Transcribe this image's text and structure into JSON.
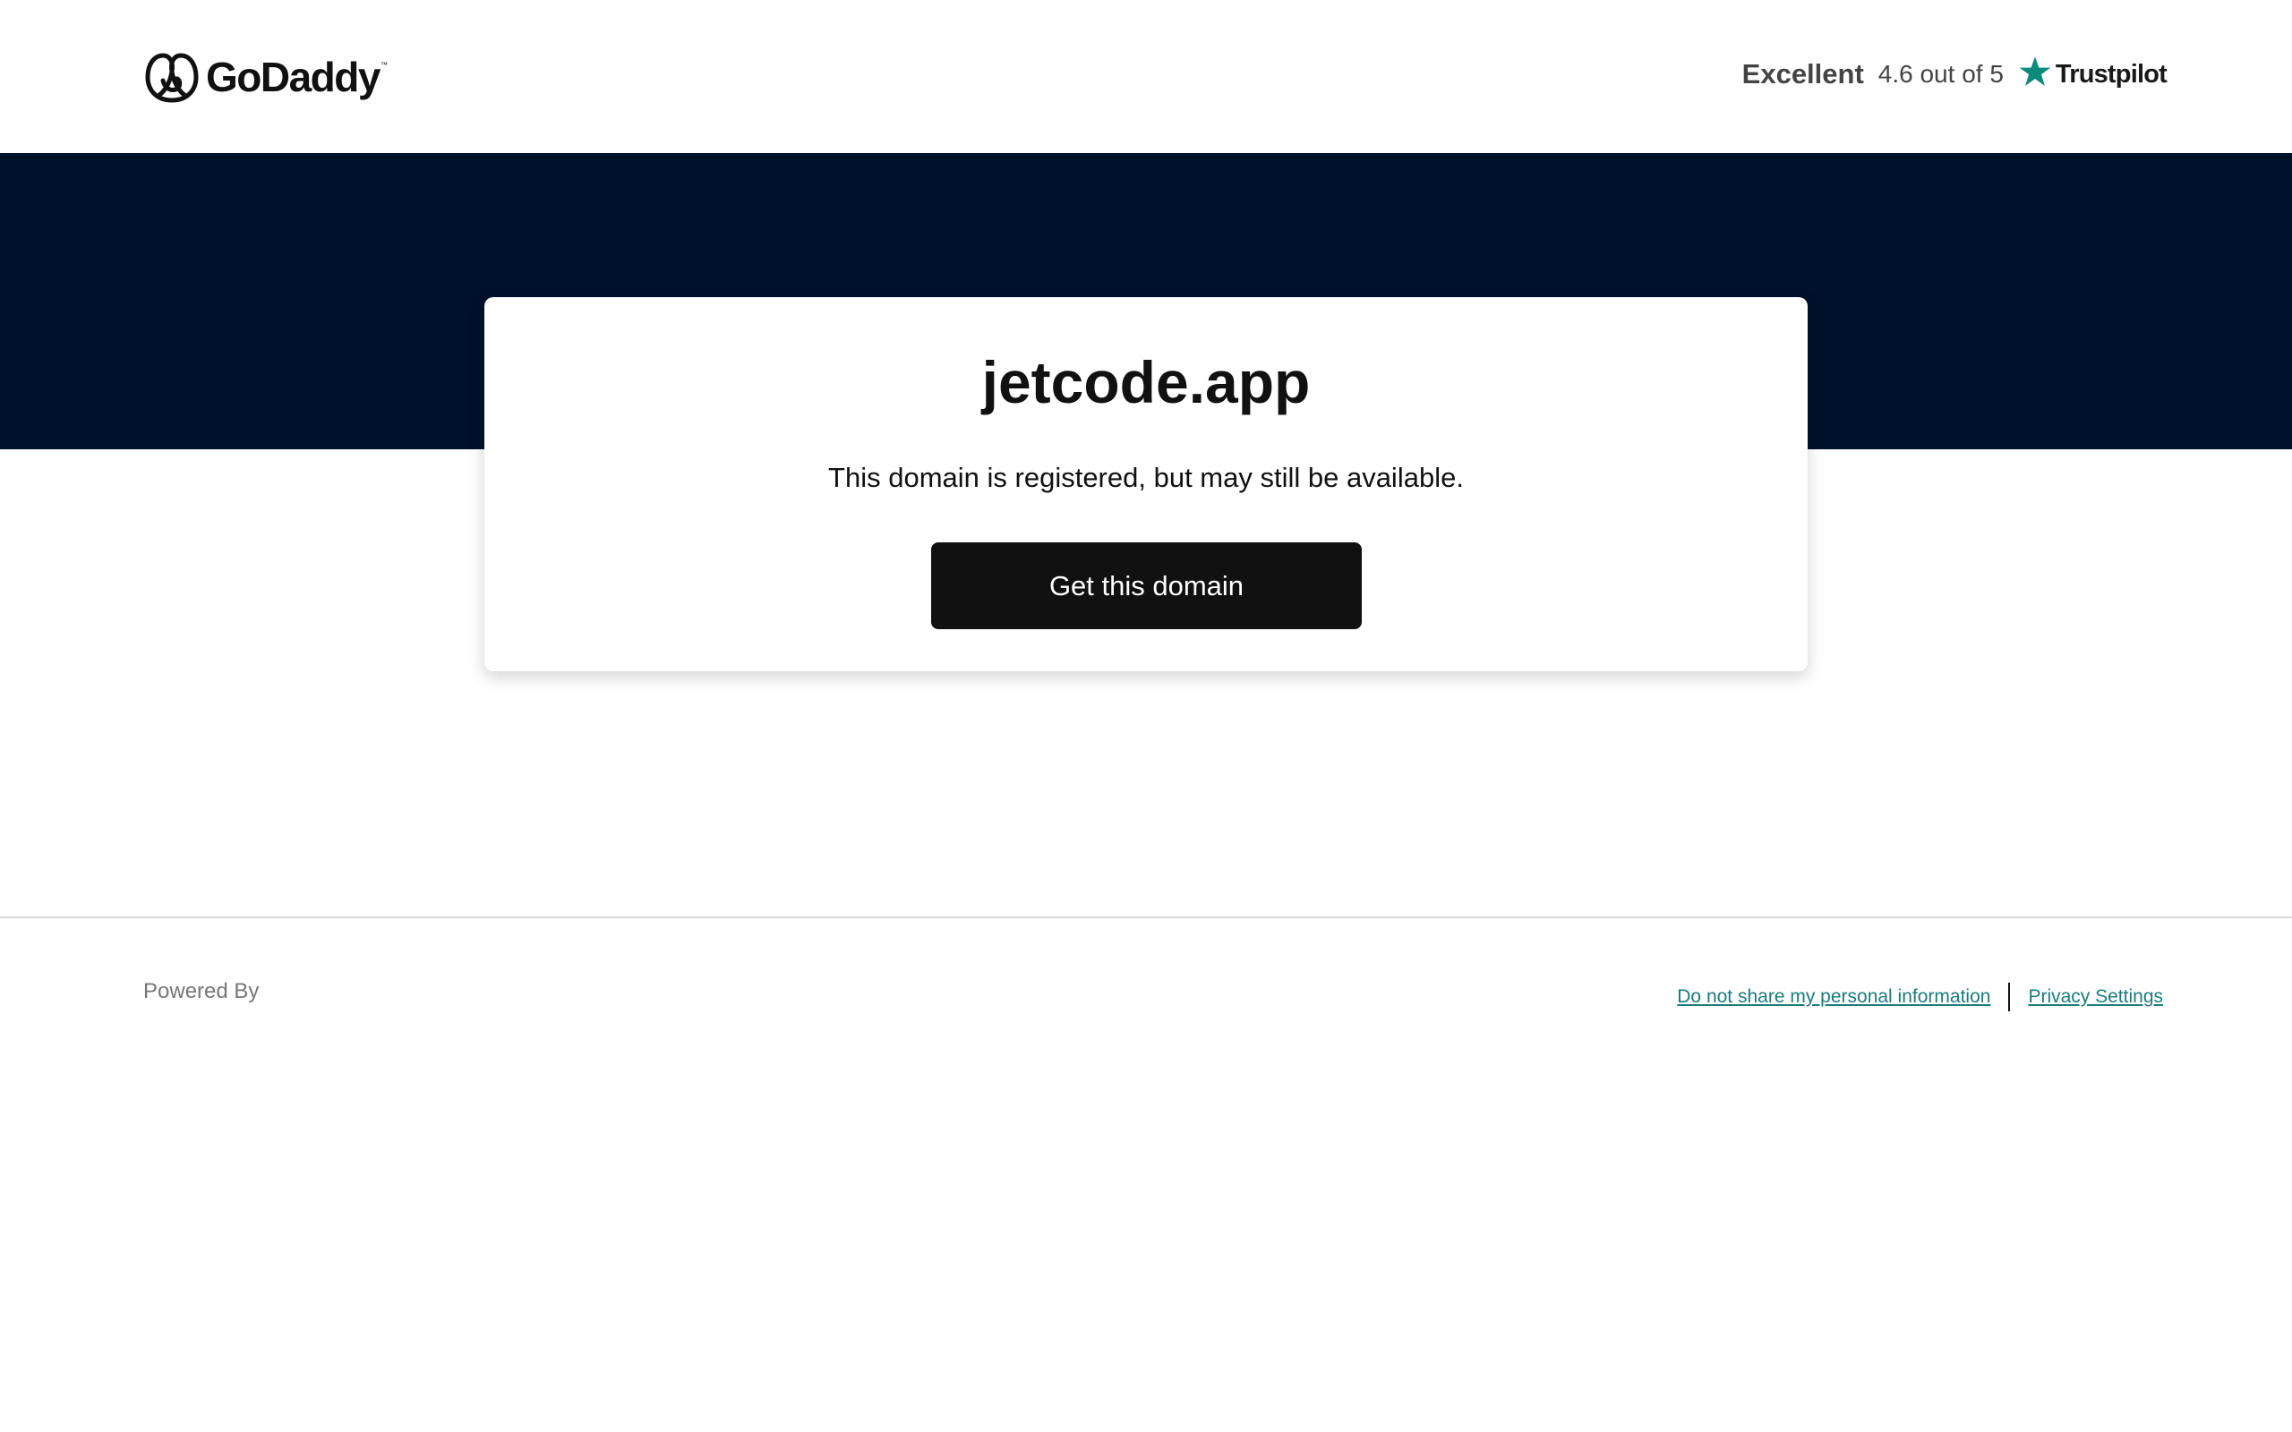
{
  "header": {
    "logo_text": "GoDaddy",
    "rating_label": "Excellent",
    "rating_score": "4.6 out of 5",
    "trustpilot_text": "Trustpilot",
    "trustpilot_color": "#00b67a"
  },
  "theme": {
    "band_color": "#00112c",
    "cta_color": "#111111",
    "link_color": "#1c7b7b"
  },
  "card": {
    "domain": "jetcode.app",
    "subtitle": "This domain is registered, but may still be available.",
    "cta_label": "Get this domain"
  },
  "footer": {
    "powered_by": "Powered By",
    "links": [
      "Do not share my personal information",
      "Privacy Settings"
    ]
  }
}
